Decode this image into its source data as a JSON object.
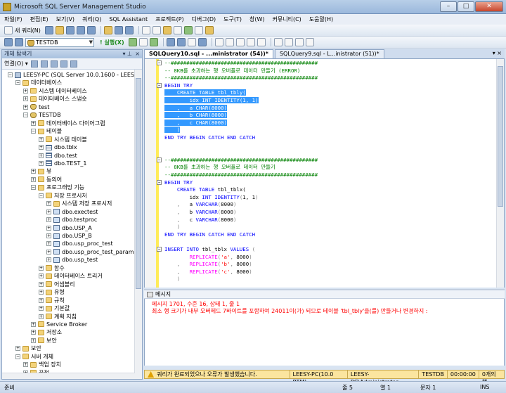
{
  "window": {
    "title": "Microsoft SQL Server Management Studio"
  },
  "menu": [
    "파일(F)",
    "편집(E)",
    "보기(V)",
    "쿼리(Q)",
    "SQL Assistant",
    "프로젝트(P)",
    "디버그(D)",
    "도구(T)",
    "창(W)",
    "커뮤니티(C)",
    "도움말(H)"
  ],
  "toolbar": {
    "new_query": "새 쿼리(N)",
    "database": "TESTDB",
    "execute": "! 실행(X)"
  },
  "explorer": {
    "title": "개체 탐색기",
    "connect": "연결(O) ▾",
    "tree": [
      {
        "label": "LEESY-PC (SQL Server 10.0.1600 - LEESY-PC\\",
        "level": 0,
        "exp": "-",
        "icon": "server"
      },
      {
        "label": "데이터베이스",
        "level": 1,
        "exp": "-",
        "icon": "folder"
      },
      {
        "label": "시스템 데이터베이스",
        "level": 2,
        "exp": "+",
        "icon": "folder"
      },
      {
        "label": "데이터베이스 스냅숏",
        "level": 2,
        "exp": "+",
        "icon": "folder"
      },
      {
        "label": "test",
        "level": 2,
        "exp": "+",
        "icon": "db"
      },
      {
        "label": "TESTDB",
        "level": 2,
        "exp": "-",
        "icon": "db"
      },
      {
        "label": "데이터베이스 다이어그램",
        "level": 3,
        "exp": "+",
        "icon": "folder"
      },
      {
        "label": "테이블",
        "level": 3,
        "exp": "-",
        "icon": "folder"
      },
      {
        "label": "시스템 테이블",
        "level": 4,
        "exp": "+",
        "icon": "folder"
      },
      {
        "label": "dbo.tblx",
        "level": 4,
        "exp": "+",
        "icon": "table"
      },
      {
        "label": "dbo.test",
        "level": 4,
        "exp": "+",
        "icon": "table"
      },
      {
        "label": "dbo.TEST_1",
        "level": 4,
        "exp": "+",
        "icon": "table"
      },
      {
        "label": "뷰",
        "level": 3,
        "exp": "+",
        "icon": "folder"
      },
      {
        "label": "동의어",
        "level": 3,
        "exp": "+",
        "icon": "folder"
      },
      {
        "label": "프로그래밍 기능",
        "level": 3,
        "exp": "-",
        "icon": "folder"
      },
      {
        "label": "저장 프로시저",
        "level": 4,
        "exp": "-",
        "icon": "folder"
      },
      {
        "label": "시스템 저장 프로시저",
        "level": 5,
        "exp": "+",
        "icon": "folder"
      },
      {
        "label": "dbo.exectest",
        "level": 5,
        "exp": "+",
        "icon": "proc"
      },
      {
        "label": "dbo.testproc",
        "level": 5,
        "exp": "+",
        "icon": "proc"
      },
      {
        "label": "dbo.USP_A",
        "level": 5,
        "exp": "+",
        "icon": "proc"
      },
      {
        "label": "dbo.USP_B",
        "level": 5,
        "exp": "+",
        "icon": "proc"
      },
      {
        "label": "dbo.usp_proc_test",
        "level": 5,
        "exp": "+",
        "icon": "proc"
      },
      {
        "label": "dbo.usp_proc_test_paramete",
        "level": 5,
        "exp": "+",
        "icon": "proc"
      },
      {
        "label": "dbo.usp_test",
        "level": 5,
        "exp": "+",
        "icon": "proc"
      },
      {
        "label": "함수",
        "level": 4,
        "exp": "+",
        "icon": "folder"
      },
      {
        "label": "데이터베이스 트리거",
        "level": 4,
        "exp": "+",
        "icon": "folder"
      },
      {
        "label": "어셈블리",
        "level": 4,
        "exp": "+",
        "icon": "folder"
      },
      {
        "label": "유형",
        "level": 4,
        "exp": "+",
        "icon": "folder"
      },
      {
        "label": "규칙",
        "level": 4,
        "exp": "+",
        "icon": "folder"
      },
      {
        "label": "기본값",
        "level": 4,
        "exp": "+",
        "icon": "folder"
      },
      {
        "label": "계획 지침",
        "level": 4,
        "exp": "+",
        "icon": "folder"
      },
      {
        "label": "Service Broker",
        "level": 3,
        "exp": "+",
        "icon": "folder"
      },
      {
        "label": "저장소",
        "level": 3,
        "exp": "+",
        "icon": "folder"
      },
      {
        "label": "보안",
        "level": 3,
        "exp": "+",
        "icon": "folder"
      },
      {
        "label": "보안",
        "level": 1,
        "exp": "+",
        "icon": "folder"
      },
      {
        "label": "서버 개체",
        "level": 1,
        "exp": "-",
        "icon": "folder"
      },
      {
        "label": "백업 장치",
        "level": 2,
        "exp": "+",
        "icon": "folder"
      },
      {
        "label": "끝점",
        "level": 2,
        "exp": "+",
        "icon": "folder"
      }
    ]
  },
  "tabs": [
    {
      "label": "SQLQuery10.sql - ...ministrator (54))*",
      "active": true
    },
    {
      "label": "SQLQuery9.sql - L...inistrator (51))*",
      "active": false
    }
  ],
  "code": [
    [
      [
        "cm",
        "--###############################################"
      ]
    ],
    [
      [
        "cm",
        "-- 8KB를 초과하는 행 오버플로 데이터 만들기 (ERROR)"
      ]
    ],
    [
      [
        "cm",
        "--###############################################"
      ]
    ],
    [
      [
        "kw",
        "BEGIN TRY"
      ]
    ],
    [
      [
        "sel",
        "    "
      ],
      [
        "kw sel",
        "CREATE TABLE"
      ],
      [
        "sel",
        " tbl_tbly("
      ]
    ],
    [
      [
        "sel",
        "        idx "
      ],
      [
        "kw sel",
        "INT IDENTITY"
      ],
      [
        "sel",
        "(1, 1)"
      ]
    ],
    [
      [
        "sel",
        "    ,   a "
      ],
      [
        "kw sel",
        "CHAR"
      ],
      [
        "sel",
        "(8000)"
      ]
    ],
    [
      [
        "sel",
        "    ,   b "
      ],
      [
        "kw sel",
        "CHAR"
      ],
      [
        "sel",
        "(8000)"
      ]
    ],
    [
      [
        "sel",
        "    ,   c "
      ],
      [
        "kw sel",
        "CHAR"
      ],
      [
        "sel",
        "(8000)"
      ]
    ],
    [
      [
        "sel",
        "    )"
      ]
    ],
    [
      [
        "kw",
        "END TRY BEGIN CATCH END CATCH"
      ]
    ],
    [
      [
        "",
        ""
      ]
    ],
    [
      [
        "",
        ""
      ]
    ],
    [
      [
        "cm",
        "--###############################################"
      ]
    ],
    [
      [
        "cm",
        "-- 8KB를 초과하는 행 오버플로 데이터 만들기"
      ]
    ],
    [
      [
        "cm",
        "--###############################################"
      ]
    ],
    [
      [
        "kw",
        "BEGIN TRY"
      ]
    ],
    [
      [
        "",
        "    "
      ],
      [
        "kw",
        "CREATE TABLE"
      ],
      [
        "",
        " tbl_tblx("
      ]
    ],
    [
      [
        "",
        "        idx "
      ],
      [
        "kw",
        "INT IDENTITY"
      ],
      [
        "gr",
        "("
      ],
      [
        "",
        "1, 1"
      ],
      [
        "gr",
        ")"
      ]
    ],
    [
      [
        "gr",
        "    ,   "
      ],
      [
        "",
        "a "
      ],
      [
        "kw",
        "VARCHAR"
      ],
      [
        "gr",
        "("
      ],
      [
        "",
        "8000"
      ],
      [
        "gr",
        ")"
      ]
    ],
    [
      [
        "gr",
        "    ,   "
      ],
      [
        "",
        "b "
      ],
      [
        "kw",
        "VARCHAR"
      ],
      [
        "gr",
        "("
      ],
      [
        "",
        "8000"
      ],
      [
        "gr",
        ")"
      ]
    ],
    [
      [
        "gr",
        "    ,   "
      ],
      [
        "",
        "c "
      ],
      [
        "kw",
        "VARCHAR"
      ],
      [
        "gr",
        "("
      ],
      [
        "",
        "8000"
      ],
      [
        "gr",
        ")"
      ]
    ],
    [
      [
        "gr",
        "    )"
      ]
    ],
    [
      [
        "kw",
        "END TRY BEGIN CATCH END CATCH"
      ]
    ],
    [
      [
        "",
        ""
      ]
    ],
    [
      [
        "kw",
        "INSERT INTO"
      ],
      [
        "",
        " tbl_tblx "
      ],
      [
        "kw",
        "VALUES"
      ],
      [
        "gr",
        " ("
      ]
    ],
    [
      [
        "",
        "        "
      ],
      [
        "fn",
        "REPLICATE"
      ],
      [
        "gr",
        "("
      ],
      [
        "str",
        "'a'"
      ],
      [
        "gr",
        ", "
      ],
      [
        "",
        "8000"
      ],
      [
        "gr",
        ")"
      ]
    ],
    [
      [
        "gr",
        "    ,   "
      ],
      [
        "fn",
        "REPLICATE"
      ],
      [
        "gr",
        "("
      ],
      [
        "str",
        "'b'"
      ],
      [
        "gr",
        ", "
      ],
      [
        "",
        "8000"
      ],
      [
        "gr",
        ")"
      ]
    ],
    [
      [
        "gr",
        "    ,   "
      ],
      [
        "fn",
        "REPLICATE"
      ],
      [
        "gr",
        "("
      ],
      [
        "str",
        "'c'"
      ],
      [
        "gr",
        ", "
      ],
      [
        "",
        "8000"
      ],
      [
        "gr",
        ")"
      ]
    ],
    [
      [
        "gr",
        "    )"
      ]
    ]
  ],
  "messages": {
    "tab": "메시지",
    "lines": [
      "메시지 1701, 수준 16, 상태 1, 줄 1",
      "최소 행 크기가 내부 오버헤드 7바이트를 포함하여 24011이(가) 되므로 테이블 'tbl_tbly'을(를) 만들거나 변경하지 :"
    ]
  },
  "query_status": {
    "text": "쿼리가 완료되었으나 오류가 발생했습니다.",
    "server": "LEESY-PC(10.0 RTM)",
    "user": "LEESY-PC\\Administrator...",
    "db": "TESTDB",
    "time": "00:00:00",
    "rows": "0개의 행"
  },
  "statusbar": {
    "ready": "준비",
    "line": "줄 5",
    "col": "열 1",
    "ch": "문자 1",
    "ins": "INS"
  }
}
